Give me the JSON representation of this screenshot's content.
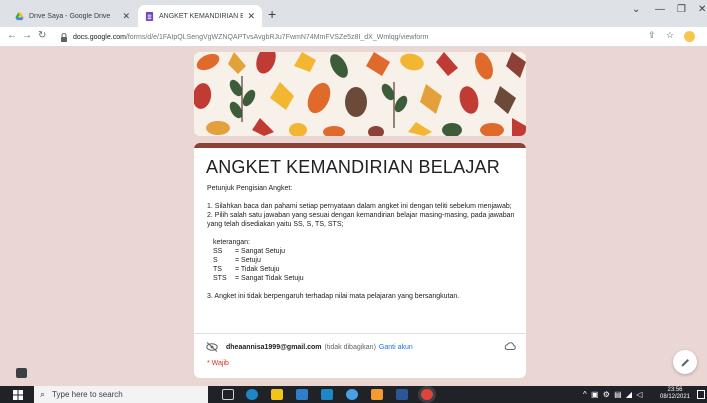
{
  "browser": {
    "tabs": [
      {
        "title": "Drive Saya - Google Drive",
        "icon": "google-drive-icon",
        "active": false
      },
      {
        "title": "ANGKET KEMANDIRIAN BELAJAR",
        "icon": "google-forms-icon",
        "active": true
      }
    ],
    "new_tab_label": "+",
    "url_domain": "docs.google.com",
    "url_path": "/forms/d/e/1FAIpQLSengVgWZNQAPTvsAvgbRJu7FwmN74MmFVSZe5z8I_dX_Wmlqg/viewform"
  },
  "form": {
    "title": "ANGKET KEMANDIRIAN BELAJAR",
    "description": {
      "intro": "Petunjuk Pengisian Angket:",
      "point1": "1. Silahkan baca dan pahami setiap pernyataan dalam angket ini dengan teliti sebelum menjawab;",
      "point2": "2. Pilih salah satu jawaban yang sesuai dengan kemandirian belajar masing-masing, pada jawaban yang telah disediakan yaitu SS, S, TS,  STS;",
      "legend_heading": "keterangan:",
      "legend": [
        {
          "code": "SS",
          "meaning": "= Sangat Setuju"
        },
        {
          "code": "S",
          "meaning": "= Setuju"
        },
        {
          "code": "TS",
          "meaning": "= Tidak Setuju"
        },
        {
          "code": "STS",
          "meaning": "= Sangat Tidak Setuju"
        }
      ],
      "point3": "3. Angket ini tidak berpengaruh terhadap nilai mata pelajaran yang bersangkutan."
    },
    "account": {
      "email": "dheaannisa1999@gmail.com",
      "note": "(tidak dibagikan)",
      "switch_label": "Ganti akun"
    },
    "required_note": "* Wajib"
  },
  "taskbar": {
    "search_placeholder": "Type here to search",
    "clock_time": "23:56",
    "clock_date": "08/12/2021"
  },
  "colors": {
    "page_background": "#ead6d2",
    "form_accent": "#8c4037",
    "link": "#1a73e8",
    "required": "#d93025"
  }
}
